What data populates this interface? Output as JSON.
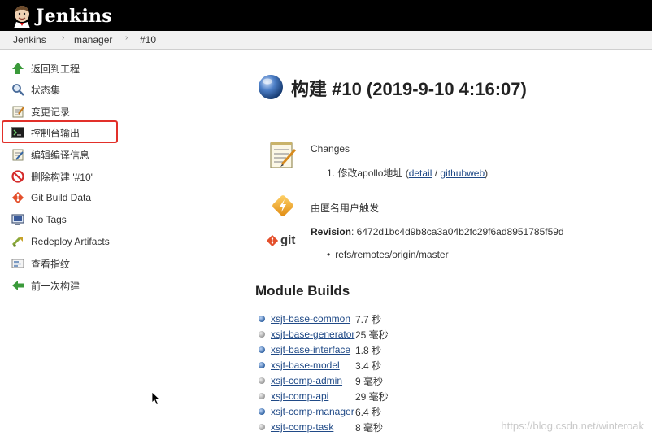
{
  "header": {
    "title": "Jenkins"
  },
  "breadcrumb": {
    "items": [
      "Jenkins",
      "manager",
      "#10"
    ]
  },
  "sidebar": {
    "items": [
      {
        "label": "返回到工程",
        "icon": "up-arrow-icon"
      },
      {
        "label": "状态集",
        "icon": "search-icon"
      },
      {
        "label": "变更记录",
        "icon": "notepad-icon"
      },
      {
        "label": "控制台输出",
        "icon": "terminal-icon"
      },
      {
        "label": "编辑编译信息",
        "icon": "edit-icon"
      },
      {
        "label": "删除构建 '#10'",
        "icon": "no-entry-icon"
      },
      {
        "label": "Git Build Data",
        "icon": "git-icon"
      },
      {
        "label": "No Tags",
        "icon": "monitor-icon"
      },
      {
        "label": "Redeploy Artifacts",
        "icon": "redeploy-icon"
      },
      {
        "label": "查看指纹",
        "icon": "fingerprint-icon"
      },
      {
        "label": "前一次构建",
        "icon": "left-arrow-icon"
      }
    ]
  },
  "main": {
    "title": "构建 #10 (2019-9-10 4:16:07)",
    "changes_label": "Changes",
    "change_entry": {
      "prefix": "1. 修改apollo地址 (",
      "detail": "detail",
      "sep": " / ",
      "githubweb": "githubweb",
      "suffix": ")"
    },
    "trigger": "由匿名用户触发",
    "revision_label": "Revision",
    "revision_value": ": 6472d1bc4d9b8ca3a04b2fc29f6ad8951785f59d",
    "branch": "refs/remotes/origin/master",
    "git_label": "git",
    "module_builds_title": "Module Builds",
    "modules": [
      {
        "name": "xsjt-base-common",
        "duration": "7.7 秒",
        "status": "blue"
      },
      {
        "name": "xsjt-base-generator",
        "duration": "25 毫秒",
        "status": "grey"
      },
      {
        "name": "xsjt-base-interface",
        "duration": "1.8 秒",
        "status": "blue"
      },
      {
        "name": "xsjt-base-model",
        "duration": "3.4 秒",
        "status": "blue"
      },
      {
        "name": "xsjt-comp-admin",
        "duration": "9 毫秒",
        "status": "grey"
      },
      {
        "name": "xsjt-comp-api",
        "duration": "29 毫秒",
        "status": "grey"
      },
      {
        "name": "xsjt-comp-manager",
        "duration": "6.4 秒",
        "status": "blue"
      },
      {
        "name": "xsjt-comp-task",
        "duration": "8 毫秒",
        "status": "grey"
      }
    ]
  },
  "watermark": "https://blog.csdn.net/winteroak",
  "colors": {
    "header_bg": "#000000",
    "link": "#204a87",
    "highlight": "#e2302a"
  }
}
